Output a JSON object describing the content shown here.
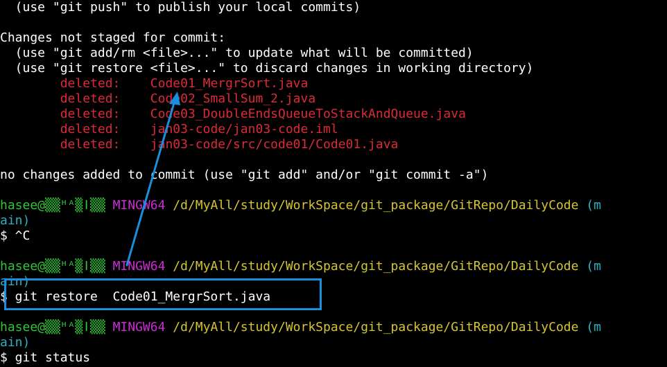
{
  "terminal": {
    "push_hint": "  (use \"git push\" to publish your local commits)",
    "not_staged_header": "Changes not staged for commit:",
    "hint_add_rm": "  (use \"git add/rm <file>...\" to update what will be committed)",
    "hint_restore": "  (use \"git restore <file>...\" to discard changes in working directory)",
    "deleted_files": [
      {
        "status": "deleted:",
        "path": "Code01_MergrSort.java"
      },
      {
        "status": "deleted:",
        "path": "Code02_SmallSum_2.java"
      },
      {
        "status": "deleted:",
        "path": "Code03_DoubleEndsQueueToStackAndQueue.java"
      },
      {
        "status": "deleted:",
        "path": "jan03-code/jan03-code.iml"
      },
      {
        "status": "deleted:",
        "path": "jan03-code/src/code01/Code01.java"
      }
    ],
    "no_changes_msg": "no changes added to commit (use \"git add\" and/or \"git commit -a\")",
    "prompt": {
      "user_host": "hasee@▒▒ᴴᴬ▒ǀ▒▒",
      "shell": "MINGW64",
      "path": "/d/MyAll/study/WorkSpace/git_package/GitRepo/DailyCode",
      "branch_open": "(m",
      "branch_close": "ain)"
    },
    "commands": [
      "$ ^C",
      "$ git restore  Code01_MergrSort.java",
      "$ git status"
    ]
  },
  "colors": {
    "deleted": "#dd2a37",
    "user_host": "#31c63a",
    "shell": "#cc2cd5",
    "path": "#d5c532",
    "branch": "#2ab2c4",
    "annotation": "#1a8fe0"
  }
}
